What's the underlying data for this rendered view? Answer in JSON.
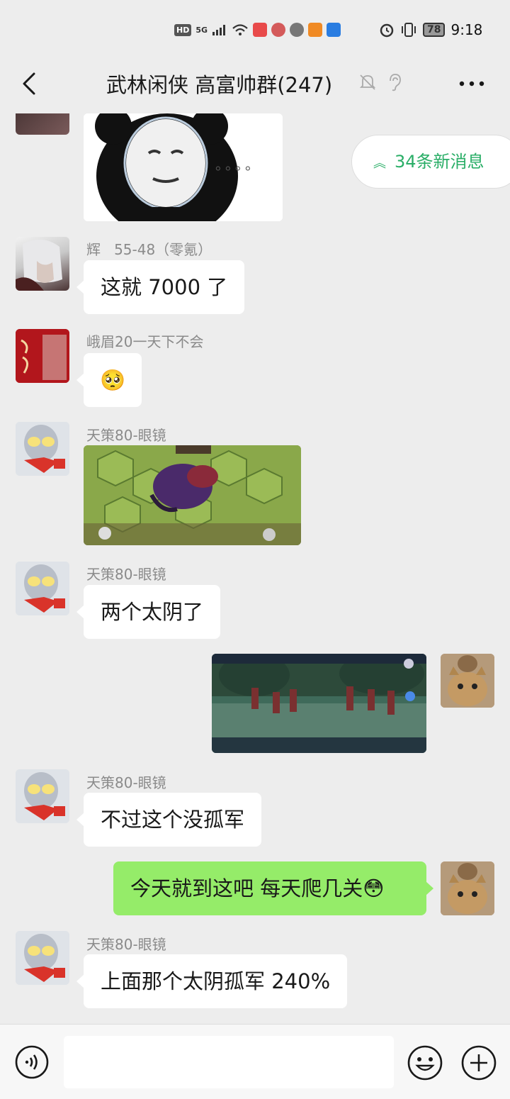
{
  "status_bar": {
    "hd": "HD",
    "network": "5G",
    "battery": "78",
    "time": "9:18"
  },
  "header": {
    "title": "武林闲侠 高富帅群(247)",
    "icons": [
      "back-icon",
      "bell-muted-icon",
      "ear-icon",
      "more-icon"
    ]
  },
  "new_messages": {
    "label": "34条新消息",
    "icon": "double-chevron-up-icon",
    "color": "#2aae67"
  },
  "messages": [
    {
      "type": "image",
      "side": "left",
      "sender": "",
      "content": "panda meme sticker",
      "caption": "。。。。"
    },
    {
      "type": "text",
      "side": "left",
      "sender": "辉   55-48（零氪）",
      "text": "这就 7000 了"
    },
    {
      "type": "emoji",
      "side": "left",
      "sender": "峨眉20一天下不会",
      "text": "🥺"
    },
    {
      "type": "image",
      "side": "left",
      "sender": "天策80-眼镜",
      "content": "game screenshot hex battlefield"
    },
    {
      "type": "text",
      "side": "left",
      "sender": "天策80-眼镜",
      "text": "两个太阴了"
    },
    {
      "type": "image",
      "side": "right",
      "sender": "",
      "content": "game screenshot battle scene"
    },
    {
      "type": "text",
      "side": "left",
      "sender": "天策80-眼镜",
      "text": "不过这个没孤军"
    },
    {
      "type": "text",
      "side": "right",
      "sender": "",
      "text": "今天就到这吧 每天爬几关😳"
    },
    {
      "type": "text",
      "side": "left",
      "sender": "天策80-眼镜",
      "text": "上面那个太阴孤军 240%"
    }
  ],
  "input_bar": {
    "value": "",
    "icons": [
      "voice-icon",
      "emoji-icon",
      "plus-icon"
    ]
  },
  "colors": {
    "background": "#ededed",
    "bubble_white": "#ffffff",
    "bubble_green": "#95ec69"
  }
}
